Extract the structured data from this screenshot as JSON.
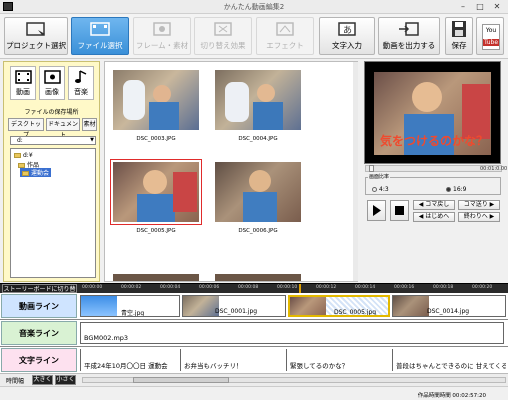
{
  "window": {
    "title": "かんたん動画編集2"
  },
  "toolbar": {
    "project_select": "プロジェクト選択",
    "file_select": "ファイル選択",
    "frame_material": "フレーム・素材",
    "transition": "切り替え効果",
    "effect": "エフェクト",
    "text_input": "文字入力",
    "export_video": "動画を出力する",
    "save": "保存",
    "youtube_line1": "You",
    "youtube_line2": "Tube"
  },
  "media_tabs": {
    "video": "動画",
    "image": "画像",
    "music": "音楽"
  },
  "folder_panel": {
    "title": "ファイルの保存場所",
    "desktop": "デスクトップ",
    "documents": "ドキュメント",
    "material": "素材",
    "drive": "d:",
    "tree": [
      "d:¥",
      "作品",
      "運動会"
    ]
  },
  "thumbnails": [
    {
      "name": "DSC_0003.JPG"
    },
    {
      "name": "DSC_0004.JPG"
    },
    {
      "name": "DSC_0005.JPG",
      "selected": true
    },
    {
      "name": "DSC_0006.JPG"
    }
  ],
  "preview": {
    "overlay_text": "気をつけるのかな？",
    "time": "00:01:0.00",
    "aspect_title": "画面比率",
    "aspect_43": "4:3",
    "aspect_169": "16:9",
    "aspect_selected": "16:9"
  },
  "player": {
    "frame_back": "コマ戻し",
    "frame_forward": "コマ送り",
    "to_start": "はじめへ",
    "to_end": "終わりへ"
  },
  "timeline": {
    "storyboard_toggle": "ストーリーボードに切り替え",
    "ticks": [
      "00:00:00",
      "00:00:02",
      "00:00:04",
      "00:00:06",
      "00:00:08",
      "00:00:10",
      "00:00:12",
      "00:00:14",
      "00:00:16",
      "00:00:18",
      "00:00:20"
    ],
    "video_line": "動画ライン",
    "music_line": "音楽ライン",
    "text_line": "文字ライン",
    "video_clips": [
      "青空.jpg",
      "DSC_0001.jpg",
      "DSC_0005.jpg",
      "DSC_0014.jpg"
    ],
    "music_clip": "BGM002.mp3",
    "text_clips": [
      "平成24年10月〇〇日 運動会",
      "お弁当もバッチリ！",
      "緊張してるのかな？",
      "普段はちゃんとできるのに 甘えてくる"
    ],
    "scale_label": "時間幅",
    "zoom_in": "大きく",
    "zoom_out": "小さく"
  },
  "status": {
    "duration_text": "作品時間時間 00:02:57:20"
  }
}
